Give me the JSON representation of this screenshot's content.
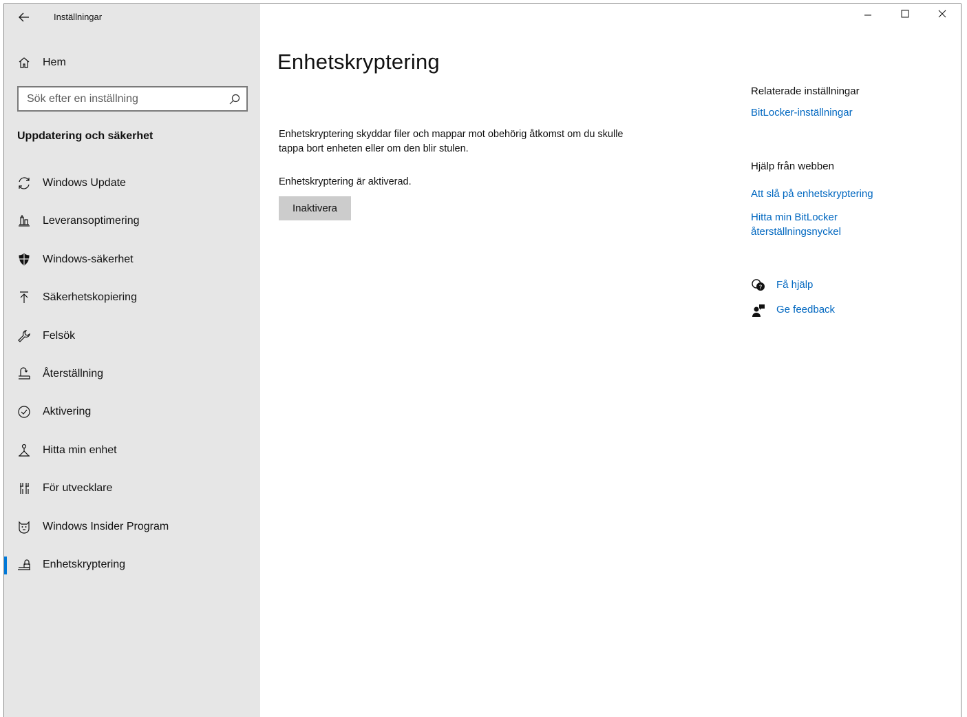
{
  "window": {
    "title": "Inställningar",
    "controls": {
      "minimize": "minimize-icon",
      "maximize": "maximize-icon",
      "close": "close-icon"
    }
  },
  "sidebar": {
    "home_label": "Hem",
    "search_placeholder": "Sök efter en inställning",
    "section_title": "Uppdatering och säkerhet",
    "items": [
      {
        "label": "Windows Update",
        "icon": "sync-icon"
      },
      {
        "label": "Leveransoptimering",
        "icon": "delivery-optimization-icon"
      },
      {
        "label": "Windows-säkerhet",
        "icon": "shield-icon"
      },
      {
        "label": "Säkerhetskopiering",
        "icon": "backup-icon"
      },
      {
        "label": "Felsök",
        "icon": "wrench-icon"
      },
      {
        "label": "Återställning",
        "icon": "recovery-icon"
      },
      {
        "label": "Aktivering",
        "icon": "check-circle-icon"
      },
      {
        "label": "Hitta min enhet",
        "icon": "find-device-icon"
      },
      {
        "label": "För utvecklare",
        "icon": "developer-icon"
      },
      {
        "label": "Windows Insider Program",
        "icon": "insider-cat-icon"
      },
      {
        "label": "Enhetskryptering",
        "icon": "device-encryption-icon",
        "active": true
      }
    ]
  },
  "main": {
    "title": "Enhetskryptering",
    "description": "Enhetskryptering skyddar filer och mappar mot obehörig åtkomst om du skulle tappa bort enheten eller om den blir stulen.",
    "status": "Enhetskryptering är aktiverad.",
    "button_label": "Inaktivera"
  },
  "related": {
    "heading": "Relaterade inställningar",
    "bitlocker_link": "BitLocker-inställningar",
    "web_help_heading": "Hjälp från webben",
    "web_link_1": "Att slå på enhetskryptering",
    "web_link_2": "Hitta min BitLocker återställningsnyckel",
    "get_help": "Få hjälp",
    "feedback": "Ge feedback"
  },
  "colors": {
    "accent": "#0078d7",
    "link": "#0067c0",
    "sidebar_bg": "#e6e6e6",
    "button_bg": "#cccccc"
  }
}
